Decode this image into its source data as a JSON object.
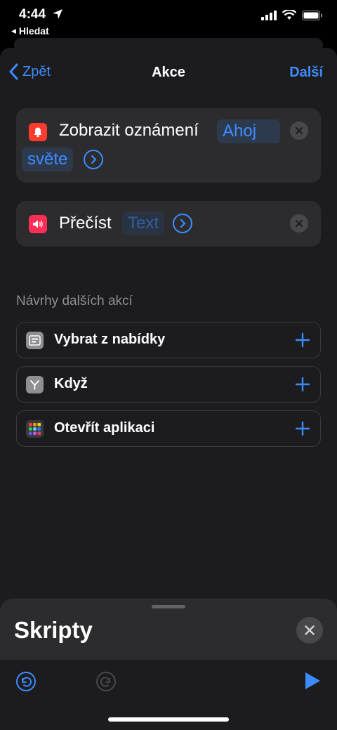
{
  "status": {
    "time": "4:44",
    "back_app": "Hledat"
  },
  "nav": {
    "back_label": "Zpět",
    "title": "Akce",
    "next_label": "Další"
  },
  "actions": [
    {
      "label": "Zobrazit oznámení",
      "token_line1": "Ahoj",
      "token_line2": "světe",
      "icon": "bell-icon",
      "color": "#ff3b30"
    },
    {
      "label": "Přečíst",
      "token": "Text",
      "icon": "speaker-icon",
      "color": "#ff2d55"
    }
  ],
  "suggestions": {
    "title": "Návrhy dalších akcí",
    "items": [
      {
        "label": "Vybrat z nabídky",
        "icon": "menu-list-icon"
      },
      {
        "label": "Když",
        "icon": "branch-icon"
      },
      {
        "label": "Otevřít aplikaci",
        "icon": "app-grid-icon"
      }
    ]
  },
  "panel": {
    "title": "Skripty"
  },
  "colors": {
    "accent": "#3d8cff",
    "background": "#1c1c1e",
    "card": "#2c2c2e"
  }
}
